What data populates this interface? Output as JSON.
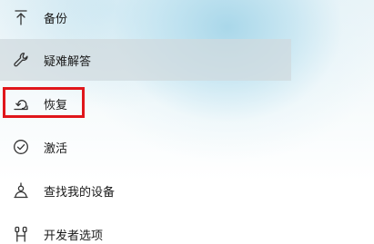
{
  "nav": {
    "items": [
      {
        "label": "备份",
        "icon": "backup-arrow-icon"
      },
      {
        "label": "疑难解答",
        "icon": "wrench-icon"
      },
      {
        "label": "恢复",
        "icon": "recovery-icon"
      },
      {
        "label": "激活",
        "icon": "checkmark-circle-icon"
      },
      {
        "label": "查找我的设备",
        "icon": "find-device-person-icon"
      },
      {
        "label": "开发者选项",
        "icon": "developer-tools-icon"
      }
    ]
  },
  "highlight": {
    "color": "#e0161b",
    "target": "恢复"
  },
  "colors": {
    "hover_background": "#d0dade",
    "text": "#1a1a1a"
  }
}
